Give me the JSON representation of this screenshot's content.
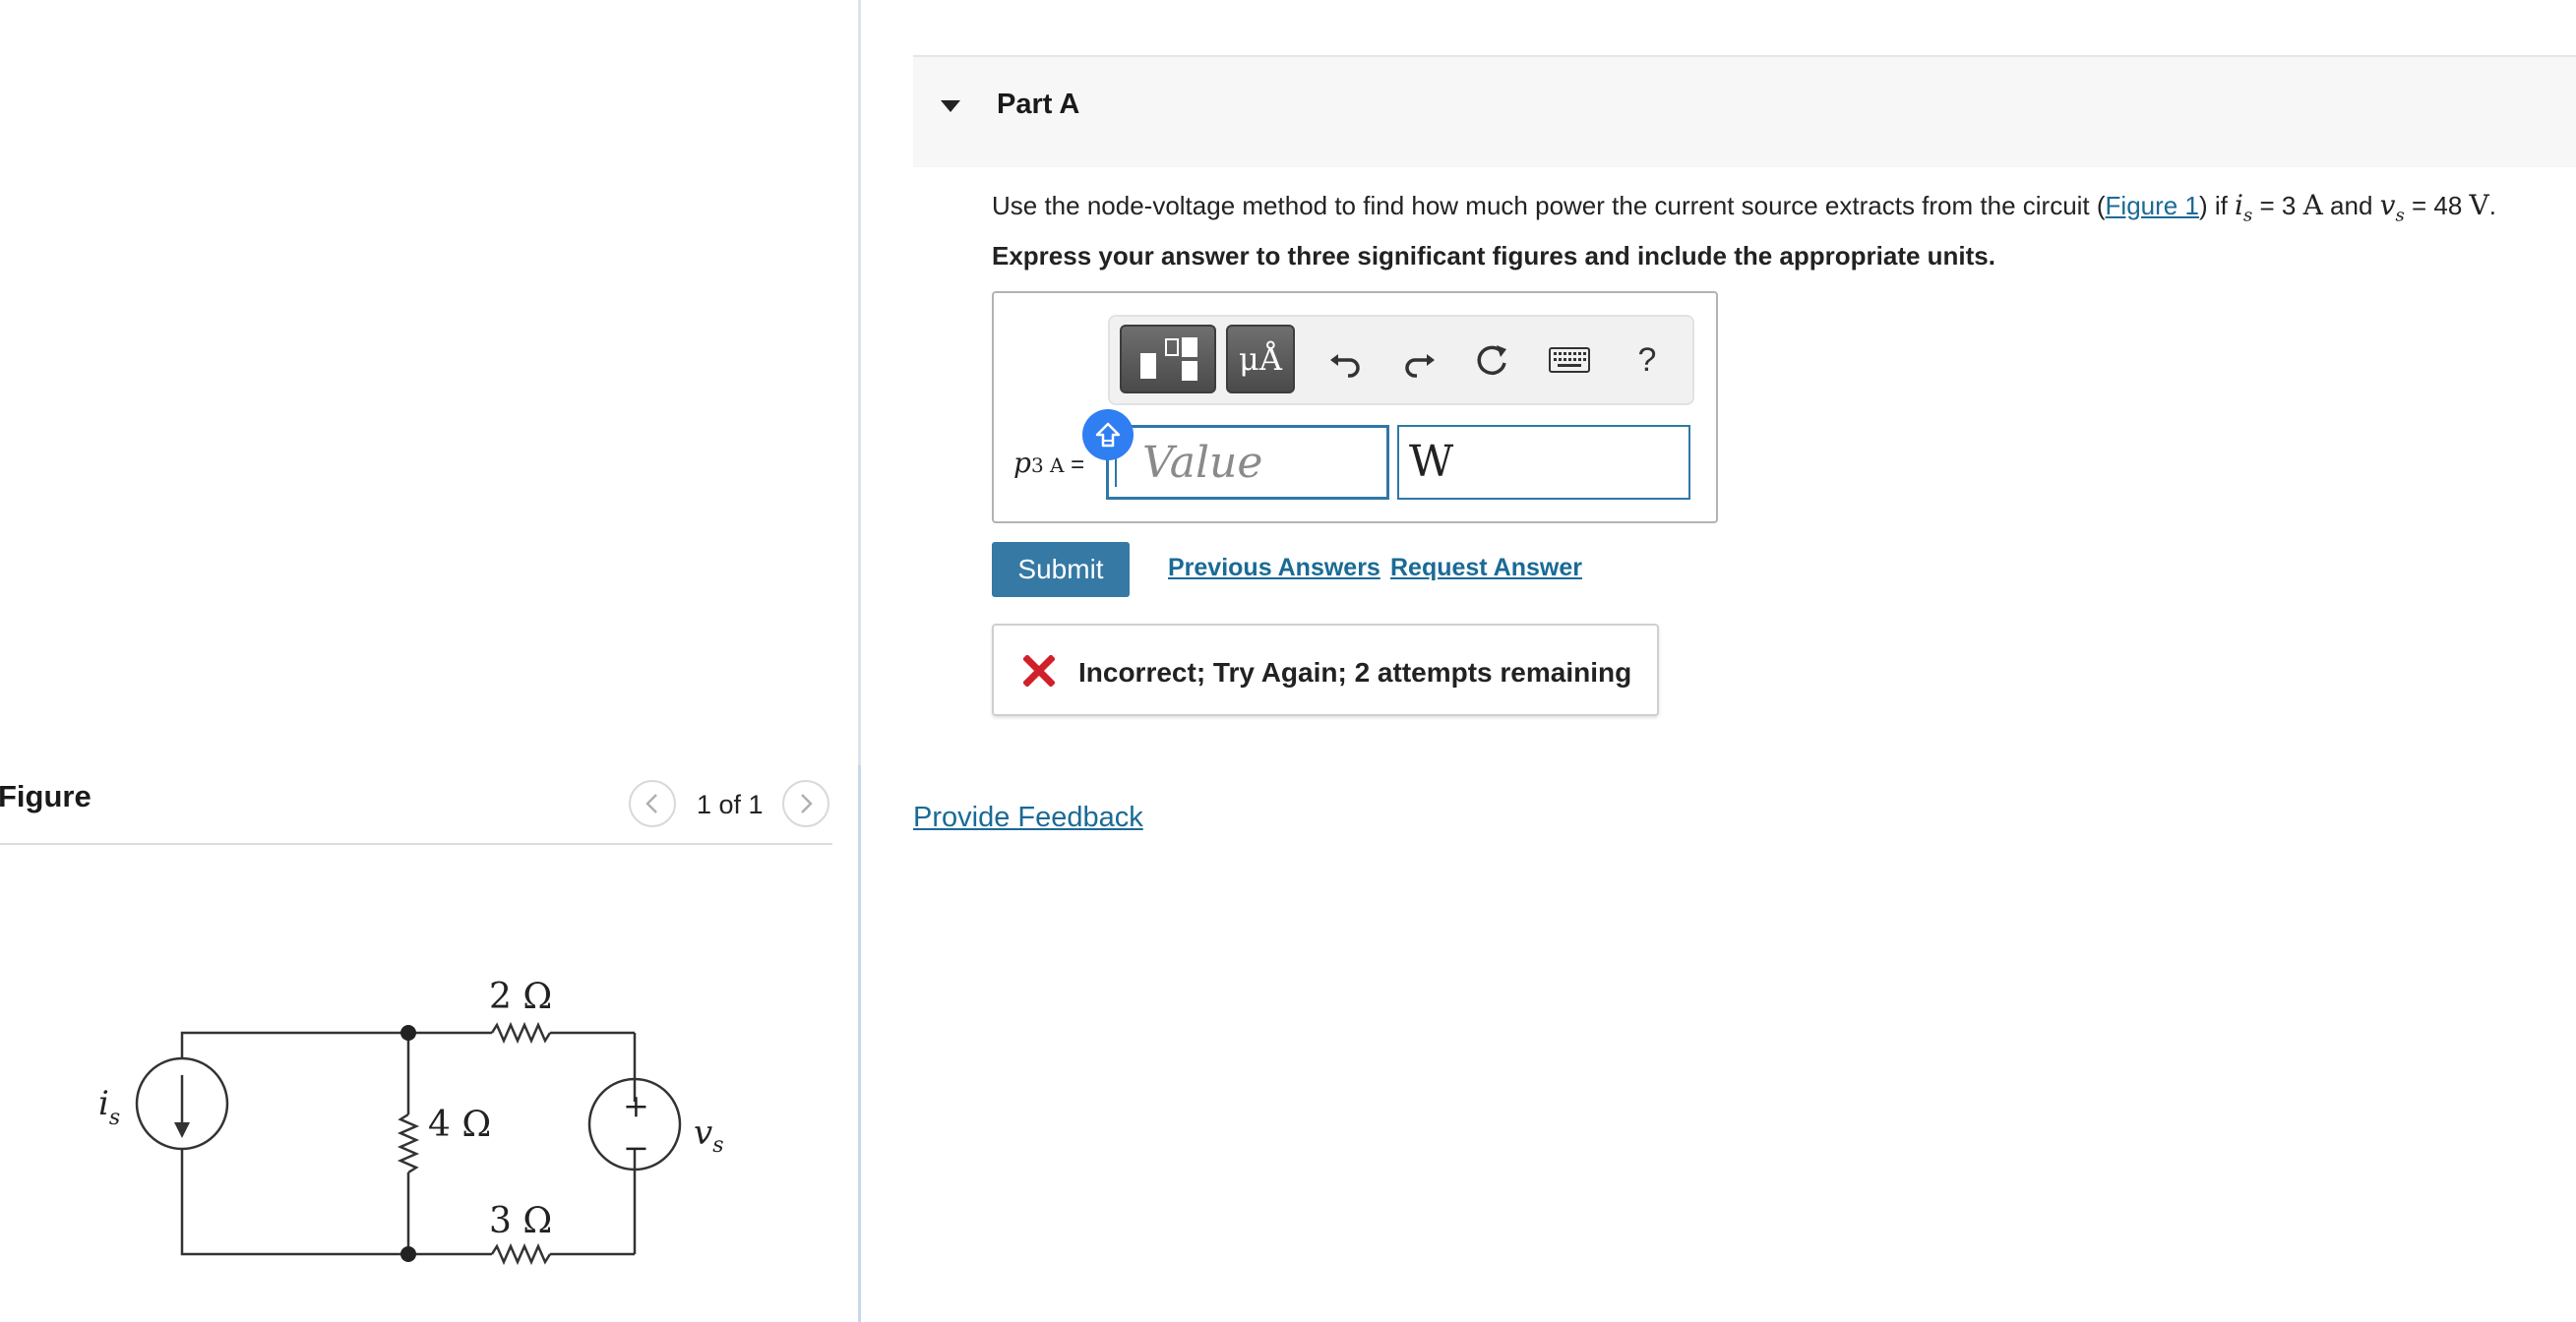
{
  "figure_panel": {
    "title": "Figure",
    "pager_text": "1 of 1",
    "circuit_labels": {
      "source_current": "i",
      "source_current_sub": "s",
      "r_top": "2 Ω",
      "r_mid": "4 Ω",
      "r_bottom": "3 Ω",
      "source_voltage": "v",
      "source_voltage_sub": "s",
      "plus": "+",
      "minus": "−"
    }
  },
  "part": {
    "title": "Part A",
    "question_pre": "Use the node-voltage method to find how much power the current source extracts from the circuit (",
    "question_link": "Figure 1",
    "question_mid": ") if ",
    "is_var": "i",
    "is_sub": "s",
    "is_value": " = 3 ",
    "is_unit": "A",
    "and_text": " and ",
    "vs_var": "v",
    "vs_sub": "s",
    "vs_value": " = 48 ",
    "vs_unit": "V",
    "end": ".",
    "instruction": "Express your answer to three significant figures and include the appropriate units."
  },
  "answer": {
    "label_var": "p",
    "label_sub": "3 A",
    "label_eq": " =",
    "value_placeholder": "Value",
    "units_value": "W",
    "toolbar": {
      "units_label": "μÅ",
      "help_label": "?"
    }
  },
  "actions": {
    "submit": "Submit",
    "previous_answers": "Previous Answers",
    "request_answer": "Request Answer"
  },
  "feedback": {
    "text": "Incorrect; Try Again; 2 attempts remaining",
    "status_color": "#d0212b"
  },
  "footer": {
    "provide_feedback": "Provide Feedback"
  },
  "colors": {
    "accent": "#3579a4",
    "link": "#1a6a96",
    "shift_badge": "#2f7ef2"
  }
}
